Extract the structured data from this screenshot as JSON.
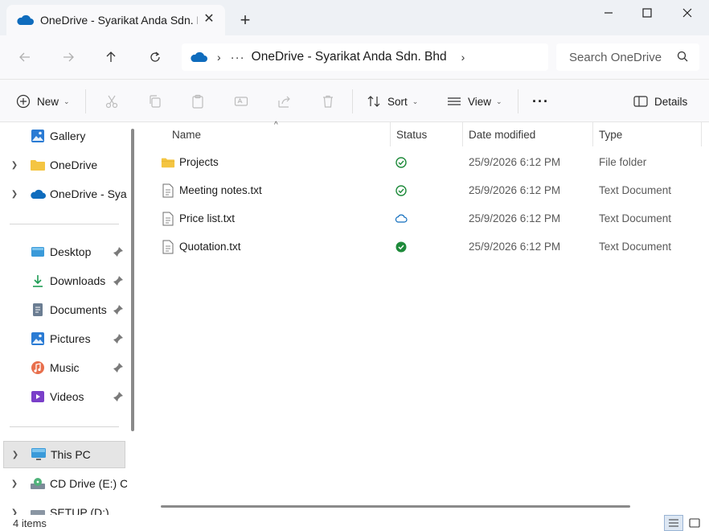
{
  "window": {
    "tab_title": "OneDrive - Syarikat Anda Sdn. Bhd",
    "tab_close": "✕",
    "new_tab": "+"
  },
  "address": {
    "more": "···",
    "crumb": "OneDrive - Syarikat Anda Sdn. Bhd"
  },
  "search": {
    "placeholder": "Search OneDrive"
  },
  "commands": {
    "new": "New",
    "sort": "Sort",
    "view": "View",
    "more": "···",
    "details": "Details"
  },
  "sidebar": {
    "top": [
      {
        "label": "Gallery",
        "icon": "gallery-icon"
      },
      {
        "label": "OneDrive",
        "icon": "folder-icon"
      },
      {
        "label": "OneDrive - Syarikat Anda Sdn. Bhd",
        "icon": "onedrive-cloud-icon"
      }
    ],
    "quick": [
      {
        "label": "Desktop",
        "icon": "desktop-icon"
      },
      {
        "label": "Downloads",
        "icon": "download-icon"
      },
      {
        "label": "Documents",
        "icon": "documents-icon"
      },
      {
        "label": "Pictures",
        "icon": "pictures-icon"
      },
      {
        "label": "Music",
        "icon": "music-icon"
      },
      {
        "label": "Videos",
        "icon": "videos-icon"
      }
    ],
    "devices": [
      {
        "label": "This PC",
        "icon": "this-pc-icon"
      },
      {
        "label": "CD Drive (E:) CC",
        "icon": "cd-drive-icon"
      },
      {
        "label": "SETUP (D:)",
        "icon": "drive-icon"
      }
    ]
  },
  "columns": {
    "name": "Name",
    "status": "Status",
    "date": "Date modified",
    "type": "Type"
  },
  "files": [
    {
      "name": "Projects",
      "status": "available",
      "date": "25/9/2026 6:12 PM",
      "type": "File folder"
    },
    {
      "name": "Meeting notes.txt",
      "status": "available",
      "date": "25/9/2026 6:12 PM",
      "type": "Text Document"
    },
    {
      "name": "Price list.txt",
      "status": "online-only",
      "date": "25/9/2026 6:12 PM",
      "type": "Text Document"
    },
    {
      "name": "Quotation.txt",
      "status": "always-available",
      "date": "25/9/2026 6:12 PM",
      "type": "Text Document"
    }
  ],
  "status_bar": {
    "count": "4 items"
  },
  "colors": {
    "onedrive_blue": "#0f6cbd",
    "sync_green": "#1e8a3a",
    "folder_yellow": "#f4c542"
  }
}
